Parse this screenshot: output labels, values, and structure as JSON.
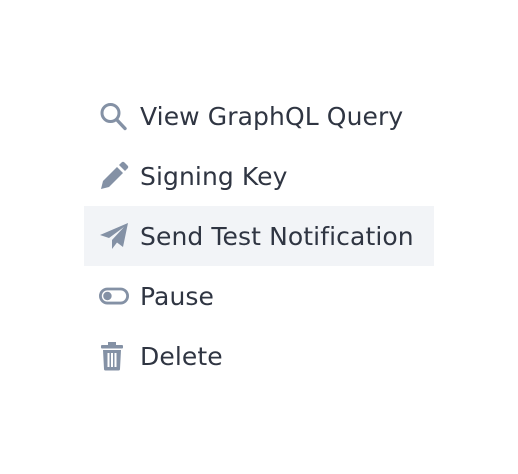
{
  "menu": {
    "icon_color": "#8491a5",
    "highlight_color": "#f2f4f7",
    "items": [
      {
        "label": "View GraphQL Query",
        "icon": "search-icon"
      },
      {
        "label": "Signing Key",
        "icon": "pencil-icon"
      },
      {
        "label": "Send Test Notification",
        "icon": "paper-plane-icon",
        "highlighted": true
      },
      {
        "label": "Pause",
        "icon": "toggle-icon"
      },
      {
        "label": "Delete",
        "icon": "trash-icon"
      }
    ]
  }
}
